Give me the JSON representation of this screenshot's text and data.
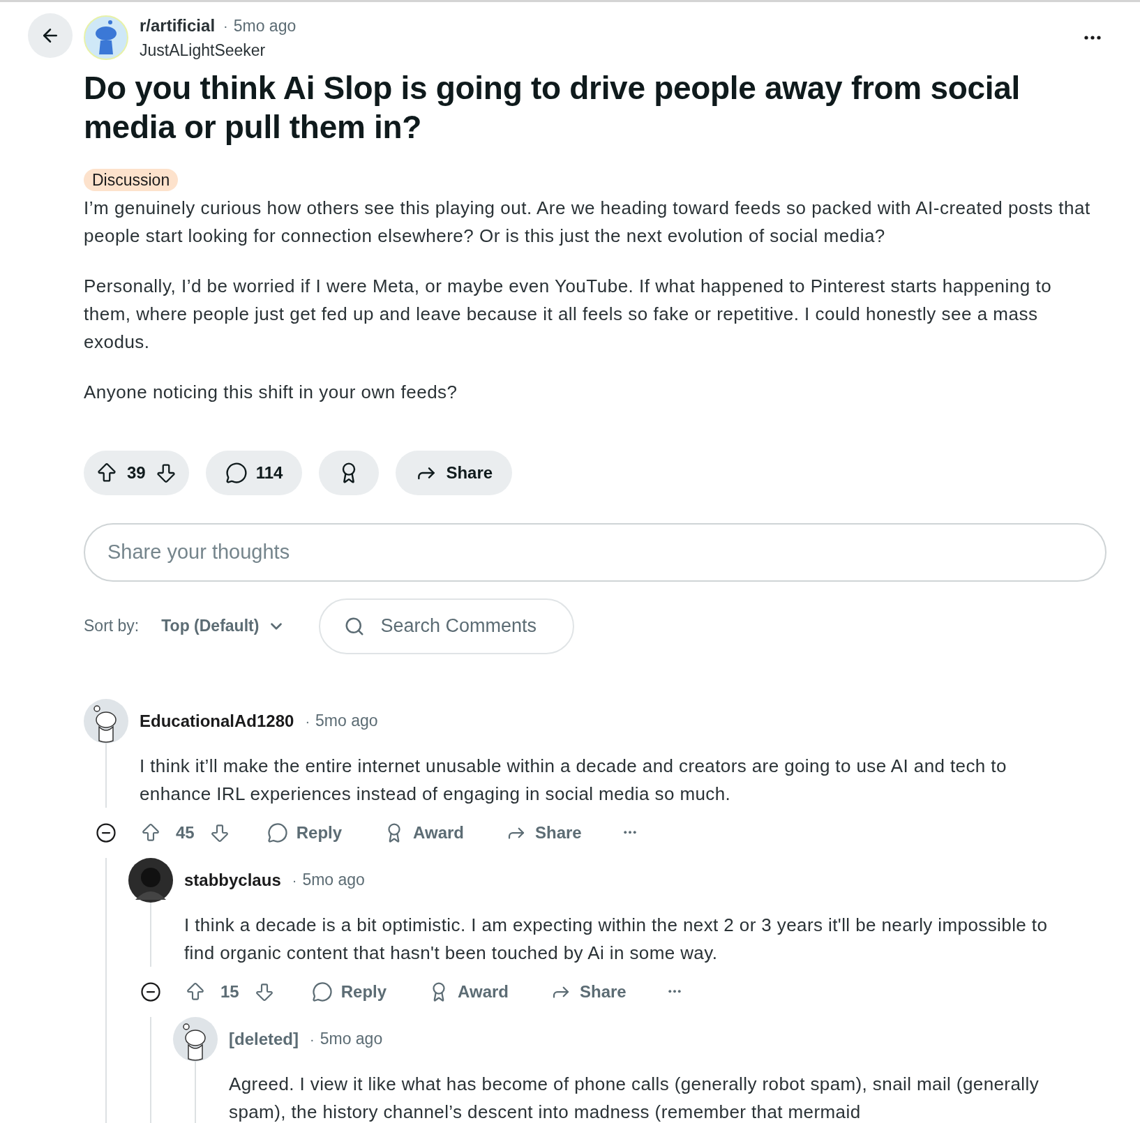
{
  "post": {
    "subreddit": "r/artificial",
    "separator": "·",
    "time": "5mo ago",
    "author": "JustALightSeeker",
    "title": "Do you think Ai Slop is going to drive people away from social media or pull them in?",
    "flair": "Discussion",
    "paragraphs": [
      "I’m genuinely curious how others see this playing out. Are we heading toward feeds so packed with AI-created posts that people start looking for connection elsewhere? Or is this just the next evolution of social media?",
      "Personally, I’d be worried if I were Meta, or maybe even YouTube. If what happened to Pinterest starts happening to them, where people just get fed up and leave because it all feels so fake or repetitive. I could honestly see a mass exodus.",
      "Anyone noticing this shift in your own feeds?"
    ],
    "votes": "39",
    "comments": "114",
    "share": "Share"
  },
  "comment_box": {
    "placeholder": "Share your thoughts"
  },
  "sort": {
    "label": "Sort by:",
    "value": "Top (Default)"
  },
  "search": {
    "placeholder": "Search Comments"
  },
  "comments": [
    {
      "author": "EducationalAd1280",
      "kind": "snoo",
      "deleted": false,
      "separator": "·",
      "time": "5mo ago",
      "body": "I think it’ll make the entire internet unusable within a decade and creators are going to use AI and tech to enhance IRL experiences instead of engaging in social media so much.",
      "votes": "45",
      "reply": "Reply",
      "award": "Award",
      "share": "Share",
      "children": [
        {
          "author": "stabbyclaus",
          "kind": "dark",
          "deleted": false,
          "separator": "·",
          "time": "5mo ago",
          "body": "I think a decade is a bit optimistic. I am expecting within the next 2 or 3 years it'll be nearly impossible to find organic content that hasn't been touched by Ai in some way.",
          "votes": "15",
          "reply": "Reply",
          "award": "Award",
          "share": "Share",
          "children": [
            {
              "author": "[deleted]",
              "kind": "snoo",
              "deleted": true,
              "separator": "·",
              "time": "5mo ago",
              "body": "Agreed. I view it like what has become of phone calls (generally robot spam), snail mail (generally spam), the history channel’s descent into madness (remember that mermaid"
            }
          ]
        }
      ]
    }
  ]
}
